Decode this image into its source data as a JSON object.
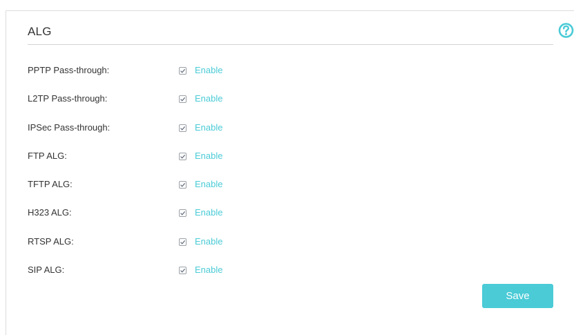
{
  "section": {
    "title": "ALG"
  },
  "help": {
    "icon": "help-icon",
    "color": "#4acbd6"
  },
  "rows": [
    {
      "label": "PPTP Pass-through:",
      "option": "Enable",
      "checked": true
    },
    {
      "label": "L2TP Pass-through:",
      "option": "Enable",
      "checked": true
    },
    {
      "label": "IPSec Pass-through:",
      "option": "Enable",
      "checked": true
    },
    {
      "label": "FTP ALG:",
      "option": "Enable",
      "checked": true
    },
    {
      "label": "TFTP ALG:",
      "option": "Enable",
      "checked": true
    },
    {
      "label": "H323 ALG:",
      "option": "Enable",
      "checked": true
    },
    {
      "label": "RTSP ALG:",
      "option": "Enable",
      "checked": true
    },
    {
      "label": "SIP ALG:",
      "option": "Enable",
      "checked": true
    }
  ],
  "actions": {
    "save_label": "Save"
  },
  "colors": {
    "accent": "#4acbd6",
    "text": "#333333",
    "divider": "#d3d3d3"
  }
}
